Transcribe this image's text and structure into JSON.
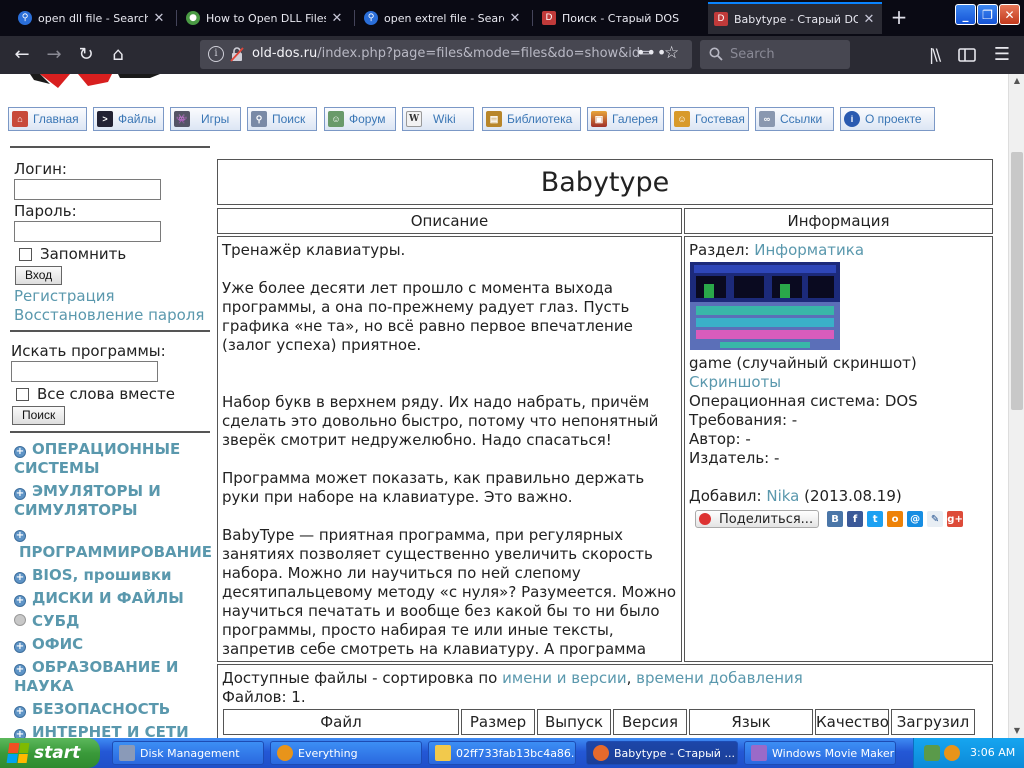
{
  "browser": {
    "tabs": [
      {
        "label": "open dll file - Search",
        "fav": "search-favicon",
        "color": "#2a6ed8"
      },
      {
        "label": "How to Open DLL Files",
        "fav": "site-favicon",
        "color": "#4a9a44"
      },
      {
        "label": "open extrel file - Search",
        "fav": "search-favicon",
        "color": "#2a6ed8"
      },
      {
        "label": "Поиск - Старый DOS",
        "fav": "dos-favicon",
        "color": "#c03a3a"
      },
      {
        "label": "Babytype - Старый DOS",
        "fav": "dos-favicon",
        "color": "#c03a3a"
      }
    ],
    "url_host": "old-dos.ru",
    "url_path": "/index.php?page=files&mode=files&do=show&id=",
    "search_placeholder": "Search"
  },
  "site": {
    "menu": [
      {
        "label": "Главная",
        "icon": "home-icon",
        "color": "#c44"
      },
      {
        "label": "Файлы",
        "icon": "terminal-icon",
        "color": "#223"
      },
      {
        "label": "Игры",
        "icon": "invader-icon",
        "color": "#556"
      },
      {
        "label": "Поиск",
        "icon": "magnifier-icon",
        "color": "#7a8aa6"
      },
      {
        "label": "Форум",
        "icon": "user-icon",
        "color": "#6a8"
      },
      {
        "label": "Wiki",
        "icon": "wiki-icon",
        "color": "#888"
      },
      {
        "label": "Библиотека",
        "icon": "book-icon",
        "color": "#b8862a"
      },
      {
        "label": "Галерея",
        "icon": "picture-icon",
        "color": "#a44"
      },
      {
        "label": "Гостевая",
        "icon": "guestbook-icon",
        "color": "#c8962a"
      },
      {
        "label": "Ссылки",
        "icon": "link-icon",
        "color": "#7a8aa6"
      },
      {
        "label": "О проекте",
        "icon": "info-icon",
        "color": "#2a5ab0"
      }
    ],
    "login": {
      "login_label": "Логин:",
      "password_label": "Пароль:",
      "remember_label": "Запомнить",
      "submit_label": "Вход",
      "register_link": "Регистрация",
      "restore_link": "Восстановление пароля"
    },
    "search": {
      "label": "Искать программы:",
      "all_words_label": "Все слова вместе",
      "submit_label": "Поиск"
    },
    "categories": [
      {
        "label": "ОПЕРАЦИОННЫЕ СИСТЕМЫ",
        "bullet": "plus"
      },
      {
        "label": "ЭМУЛЯТОРЫ И СИМУЛЯТОРЫ",
        "bullet": "plus"
      },
      {
        "label": "ПРОГРАММИРОВАНИЕ",
        "bullet": "plus"
      },
      {
        "label": "BIOS, прошивки",
        "bullet": "plus"
      },
      {
        "label": "ДИСКИ И ФАЙЛЫ",
        "bullet": "plus"
      },
      {
        "label": "СУБД",
        "bullet": "empty"
      },
      {
        "label": "ОФИС",
        "bullet": "plus"
      },
      {
        "label": "ОБРАЗОВАНИЕ И НАУКА",
        "bullet": "plus"
      },
      {
        "label": "БЕЗОПАСНОСТЬ",
        "bullet": "plus"
      },
      {
        "label": "ИНТЕРНЕТ И СЕТИ",
        "bullet": "plus"
      }
    ]
  },
  "program": {
    "title": "Babytype",
    "description_header": "Описание",
    "info_header": "Информация",
    "paragraphs": [
      "Тренажёр клавиатуры.",
      "Уже более десяти лет прошло с момента выхода программы, а она по-прежнему радует глаз. Пусть графика «не та», но всё равно первое впечатление (залог успеха) приятное.",
      "Набор букв в верхнем ряду. Их надо набрать, причём сделать это довольно быстро, потому что непонятный зверёк смотрит недружелюбно. Надо спасаться!",
      "Программа может показать, как правильно держать руки при наборе на клавиатуре. Это важно.",
      "BabyType — приятная программа, при регулярных занятиях позволяет существенно увеличить скорость набора. Можно ли научиться по ней слепому десятипальцевому методу «с нуля»? Разумеется. Можно научиться печатать и вообще без какой бы то ни было программы, просто набирая те или иные тексты, запретив себе смотреть на клавиатуру. А программа упрощает процесс обучения, делает его интереснее."
    ],
    "info": {
      "section_label": "Раздел:",
      "section_value": "Информатика",
      "screenshot_caption": "game (случайный скриншот)",
      "screenshots_link": "Скриншоты",
      "os_line": "Операционная система: DOS",
      "requirements_line": "Требования: -",
      "author_line": "Автор: -",
      "publisher_line": "Издатель: -",
      "added_label": "Добавил:",
      "added_user": "Nika",
      "added_date": "(2013.08.19)",
      "share_label": "Поделиться..."
    },
    "files": {
      "sort_prefix": "Доступные файлы - сортировка по",
      "sort_by_name": "имени и версии",
      "sort_by_time": "времени добавления",
      "count_line": "Файлов: 1.",
      "columns": [
        "Файл",
        "Размер",
        "Выпуск",
        "Версия",
        "Язык",
        "Качество",
        "Загрузил"
      ]
    }
  },
  "taskbar": {
    "start_label": "start",
    "tasks": [
      {
        "label": "Disk Management"
      },
      {
        "label": "Everything"
      },
      {
        "label": "02ff733fab13bc4a86..."
      },
      {
        "label": "Babytype - Старый ..."
      },
      {
        "label": "Windows Movie Maker"
      }
    ],
    "clock": "3:06 AM"
  }
}
